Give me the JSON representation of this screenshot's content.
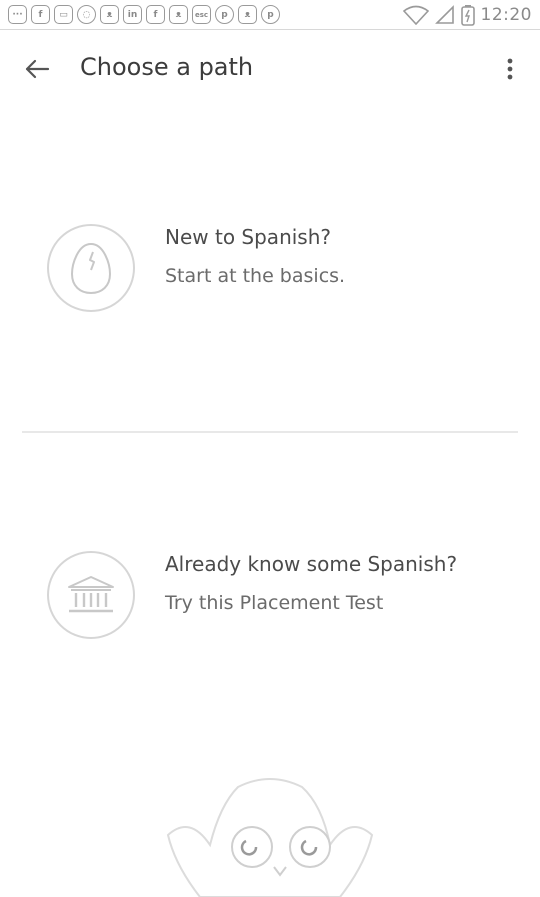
{
  "status_bar": {
    "time": "12:20",
    "icons": [
      "more-icon",
      "facebook-icon",
      "message-icon",
      "chat-icon",
      "cat-icon",
      "linkedin-icon",
      "facebook-icon",
      "cat-icon",
      "esc-icon",
      "pinterest-icon",
      "cat-icon",
      "pinterest-icon",
      "wifi-icon",
      "signal-icon",
      "battery-icon"
    ],
    "icon_labels": {
      "more": "···",
      "facebook": "f",
      "linkedin": "in",
      "esc": "esc",
      "pinterest": "p"
    }
  },
  "header": {
    "title": "Choose a path"
  },
  "options": [
    {
      "title": "New to Spanish?",
      "subtitle": "Start at the basics.",
      "icon": "egg-icon"
    },
    {
      "title": "Already know some Spanish?",
      "subtitle": "Try this Placement Test",
      "icon": "institution-icon"
    }
  ],
  "colors": {
    "background": "#ffffff",
    "text_primary": "#4b4b4b",
    "text_secondary": "#6b6b6b",
    "outline": "#d6d6d6"
  }
}
